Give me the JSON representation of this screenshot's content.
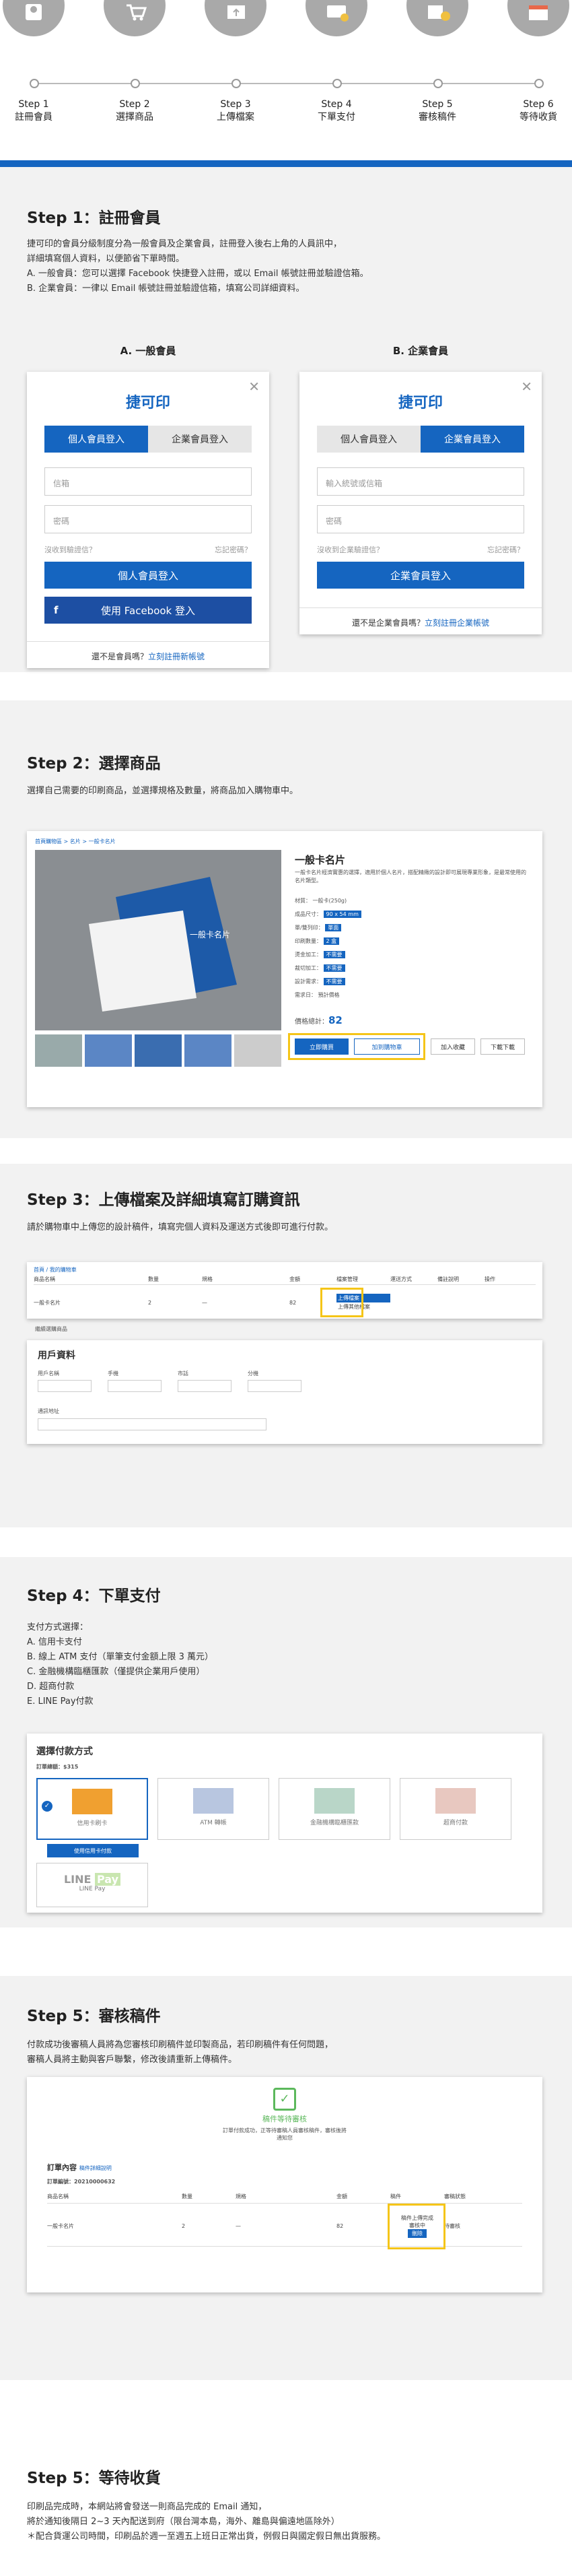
{
  "steps": [
    {
      "num": "Step 1",
      "name": "註冊會員"
    },
    {
      "num": "Step 2",
      "name": "選擇商品"
    },
    {
      "num": "Step 3",
      "name": "上傳檔案"
    },
    {
      "num": "Step 4",
      "name": "下單支付"
    },
    {
      "num": "Step 5",
      "name": "審核稿件"
    },
    {
      "num": "Step 6",
      "name": "等待收貨"
    }
  ],
  "colors": {
    "accent": "#1565c0",
    "highlight": "#f5c518",
    "band": "#f2f2f2"
  },
  "step1": {
    "title": "Step 1：註冊會員",
    "desc": [
      "捷可印的會員分級制度分為一般會員及企業會員，註冊登入後右上角的人員訊中，",
      "詳細填寫個人資料，以便節省下單時間。",
      "A. 一般會員：您可以選擇 Facebook 快捷登入註冊，或以 Email 帳號註冊並驗證信箱。",
      "B. 企業會員：一律以 Email 帳號註冊並驗證信箱，填寫公司詳細資料。"
    ],
    "label_a": "A. 一般會員",
    "label_b": "B. 企業會員",
    "logo": "捷可印",
    "tab_personal": "個人會員登入",
    "tab_business": "企業會員登入",
    "a": {
      "field1": "信箱",
      "field2": "密碼",
      "forgot_account": "沒收到驗證信？",
      "forgot_pw": "忘記密碼？",
      "login": "個人會員登入",
      "fb": "使用 Facebook 登入",
      "foot": "還不是會員嗎？",
      "foot_link": "立刻註冊新帳號"
    },
    "b": {
      "field1": "輸入統號或信箱",
      "field2": "密碼",
      "forgot_account": "沒收到企業驗證信？",
      "forgot_pw": "忘記密碼？",
      "login": "企業會員登入",
      "foot": "還不是企業會員嗎？",
      "foot_link": "立刻註冊企業帳號"
    }
  },
  "step2": {
    "title": "Step 2：選擇商品",
    "desc": "選擇自己需要的印刷商品，並選擇規格及數量，將商品加入購物車中。",
    "breadcrumb": "首頁購物區 > 名片 > 一般卡名片",
    "product_name": "一般卡名片",
    "product_desc": "一般卡名片經濟實惠的選擇，適用於個人名片，搭配精緻的設計即可展現專業形象，是最常使用的名片類型。",
    "spec_labels": [
      "材質：",
      "成品尺寸：",
      "單/雙列印：",
      "印刷數量：",
      "燙金加工：",
      "裁切加工：",
      "設計需求：",
      "需求日："
    ],
    "spec_values": [
      "一般卡(250g)",
      "90 x 54 mm",
      "單面",
      "2 盒",
      "不需要",
      "不需要",
      "不需要",
      "預計價格"
    ],
    "price_label": "價格總計：",
    "price": "82",
    "buy": "立即購買",
    "cart": "加到購物車",
    "fav": "加入收藏",
    "share": "下載下載"
  },
  "step3": {
    "title": "Step 3：上傳檔案及詳細填寫訂購資訊",
    "desc": "請於購物車中上傳您的設計稿件，填寫完個人資料及運送方式後即可進行付款。",
    "crumb": "首頁 / 我的購物車",
    "headers": [
      "商品名稱",
      "數量",
      "規格",
      "金額",
      "檔案管理",
      "運送方式",
      "備註說明",
      "操作"
    ],
    "row_name": "一般卡名片",
    "row_qty": "2",
    "row_amt": "82",
    "upload1": "上傳檔案",
    "upload2": "上傳其他檔案",
    "user_title": "用戶資料",
    "user_fields": [
      "用戶名稱",
      "手機",
      "市話",
      "分機"
    ],
    "addr_label": "通訊地址",
    "continue": "繼續選購商品"
  },
  "step4": {
    "title": "Step 4：下單支付",
    "desc": [
      "支付方式選擇：",
      "A. 信用卡支付",
      "B. 線上 ATM 支付（單筆支付金額上限 3 萬元）",
      "C. 金融機構臨櫃匯款（僅提供企業用戶使用）",
      "D. 超商付款",
      "E. LINE Pay付款"
    ],
    "card_title": "選擇付款方式",
    "order_amount": "訂單總額：$315",
    "options": [
      "信用卡刷卡",
      "ATM 轉帳",
      "金融機構臨櫃匯款",
      "超商付款",
      "LINE Pay"
    ],
    "confirm": "使用信用卡付款"
  },
  "step5a": {
    "title": "Step 5：審核稿件",
    "desc": [
      "付款成功後審稿人員將為您審核印刷稿件並印製商品，若印刷稿件有任何問題，",
      "審稿人員將主動與客戶聯繫，修改後請重新上傳稿件。"
    ],
    "status_title": "稿件等待審核",
    "status_desc": "訂單付款成功，正等待審稿人員審核稿件，審核後將通知您",
    "order_title": "訂單內容",
    "order_link": "稿件詳細說明",
    "order_no": "訂單編號：20210000632",
    "headers": [
      "商品名稱",
      "數量",
      "規格",
      "金額",
      "稿件",
      "審稿狀態"
    ],
    "row_name": "一般卡名片",
    "row_qty": "2",
    "row_amt": "82",
    "row_status": "待審核",
    "review1": "稿件上傳完成",
    "review2": "審核中",
    "review_btn": "刪除"
  },
  "step6": {
    "title": "Step 5：等待收貨",
    "desc": [
      "印刷品完成時，本網站將會發送一則商品完成的 Email 通知，",
      "將於通知後隔日 2~3 天內配送到府（限台灣本島，海外、離島與偏遠地區除外）",
      "＊配合貨運公司時間，印刷品於週一至週五上班日正常出貨，例假日與國定假日無出貨服務。"
    ]
  }
}
